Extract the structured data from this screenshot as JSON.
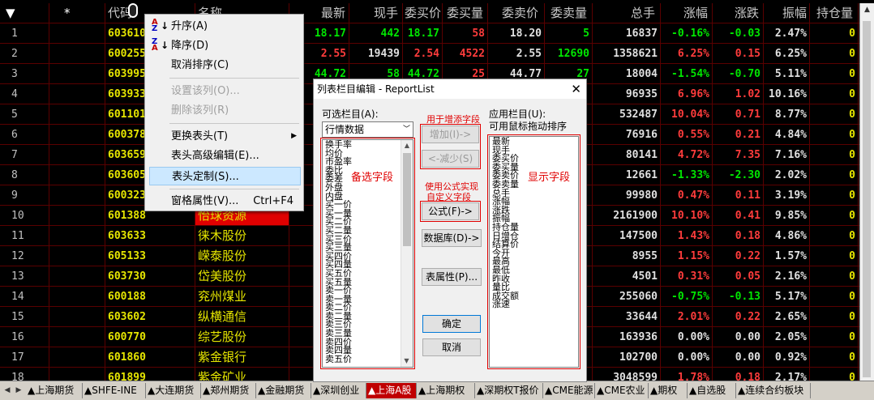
{
  "header": {
    "star": "*",
    "columns": [
      "代码",
      "名称",
      "最新",
      "现手",
      "委买价",
      "委买量",
      "委卖价",
      "委卖量",
      "总手",
      "涨幅",
      "涨跌",
      "振幅",
      "持仓量"
    ]
  },
  "rows": [
    {
      "n": "1",
      "code": "603610",
      "name": "",
      "last": "18.17",
      "vol": "442",
      "bid": "18.17",
      "bidq": "58",
      "ask": "18.20",
      "askq": "5",
      "total": "16837",
      "chg": "-0.16%",
      "diff": "-0.03",
      "amp": "2.47%",
      "oi": "0"
    },
    {
      "n": "2",
      "code": "600255",
      "name": "",
      "last": "2.55",
      "vol": "19439",
      "bid": "2.54",
      "bidq": "4522",
      "ask": "2.55",
      "askq": "12690",
      "total": "1358621",
      "chg": "6.25%",
      "diff": "0.15",
      "amp": "6.25%",
      "oi": "0"
    },
    {
      "n": "3",
      "code": "603995",
      "name": "",
      "last": "44.72",
      "vol": "58",
      "bid": "44.72",
      "bidq": "25",
      "ask": "44.77",
      "askq": "27",
      "total": "18004",
      "chg": "-1.54%",
      "diff": "-0.70",
      "amp": "5.11%",
      "oi": "0"
    },
    {
      "n": "4",
      "code": "603933",
      "name": "",
      "last": "",
      "vol": "",
      "bid": "",
      "bidq": "",
      "ask": "",
      "askq": "",
      "total": "96935",
      "chg": "6.96%",
      "diff": "1.02",
      "amp": "10.16%",
      "oi": "0"
    },
    {
      "n": "5",
      "code": "601101",
      "name": "",
      "last": "",
      "vol": "",
      "bid": "",
      "bidq": "",
      "ask": "",
      "askq": "",
      "total": "532487",
      "chg": "10.04%",
      "diff": "0.71",
      "amp": "8.77%",
      "oi": "0"
    },
    {
      "n": "6",
      "code": "600378",
      "name": "",
      "last": "",
      "vol": "",
      "bid": "",
      "bidq": "",
      "ask": "",
      "askq": "",
      "total": "76916",
      "chg": "0.55%",
      "diff": "0.21",
      "amp": "4.84%",
      "oi": "0"
    },
    {
      "n": "7",
      "code": "603659",
      "name": "",
      "last": "",
      "vol": "",
      "bid": "",
      "bidq": "",
      "ask": "",
      "askq": "",
      "total": "80141",
      "chg": "4.72%",
      "diff": "7.35",
      "amp": "7.16%",
      "oi": "0"
    },
    {
      "n": "8",
      "code": "603605",
      "name": "",
      "last": "",
      "vol": "",
      "bid": "",
      "bidq": "",
      "ask": "",
      "askq": "",
      "total": "12661",
      "chg": "-1.33%",
      "diff": "-2.30",
      "amp": "2.02%",
      "oi": "0"
    },
    {
      "n": "9",
      "code": "600323",
      "name": "",
      "last": "",
      "vol": "",
      "bid": "",
      "bidq": "",
      "ask": "",
      "askq": "",
      "total": "99980",
      "chg": "0.47%",
      "diff": "0.11",
      "amp": "3.19%",
      "oi": "0"
    },
    {
      "n": "10",
      "code": "601388",
      "name": "怡球资源",
      "last": "",
      "vol": "",
      "bid": "",
      "bidq": "",
      "ask": "",
      "askq": "",
      "total": "2161900",
      "chg": "10.10%",
      "diff": "0.41",
      "amp": "9.85%",
      "oi": "0"
    },
    {
      "n": "11",
      "code": "603633",
      "name": "徕木股份",
      "last": "",
      "vol": "",
      "bid": "",
      "bidq": "",
      "ask": "",
      "askq": "",
      "total": "147500",
      "chg": "1.43%",
      "diff": "0.18",
      "amp": "4.86%",
      "oi": "0"
    },
    {
      "n": "12",
      "code": "605133",
      "name": "嵘泰股份",
      "last": "",
      "vol": "",
      "bid": "",
      "bidq": "",
      "ask": "",
      "askq": "",
      "total": "8955",
      "chg": "1.15%",
      "diff": "0.22",
      "amp": "1.57%",
      "oi": "0"
    },
    {
      "n": "13",
      "code": "603730",
      "name": "岱美股份",
      "last": "",
      "vol": "",
      "bid": "",
      "bidq": "",
      "ask": "",
      "askq": "",
      "total": "4501",
      "chg": "0.31%",
      "diff": "0.05",
      "amp": "2.16%",
      "oi": "0"
    },
    {
      "n": "14",
      "code": "600188",
      "name": "兖州煤业",
      "last": "",
      "vol": "",
      "bid": "",
      "bidq": "",
      "ask": "",
      "askq": "",
      "total": "255060",
      "chg": "-0.75%",
      "diff": "-0.13",
      "amp": "5.17%",
      "oi": "0"
    },
    {
      "n": "15",
      "code": "603602",
      "name": "纵横通信",
      "last": "",
      "vol": "",
      "bid": "",
      "bidq": "",
      "ask": "",
      "askq": "",
      "total": "33644",
      "chg": "2.01%",
      "diff": "0.22",
      "amp": "2.65%",
      "oi": "0"
    },
    {
      "n": "16",
      "code": "600770",
      "name": "综艺股份",
      "last": "",
      "vol": "",
      "bid": "",
      "bidq": "",
      "ask": "",
      "askq": "",
      "total": "163936",
      "chg": "0.00%",
      "diff": "0.00",
      "amp": "2.05%",
      "oi": "0"
    },
    {
      "n": "17",
      "code": "601860",
      "name": "紫金银行",
      "last": "",
      "vol": "",
      "bid": "",
      "bidq": "",
      "ask": "",
      "askq": "",
      "total": "102700",
      "chg": "0.00%",
      "diff": "0.00",
      "amp": "0.92%",
      "oi": "0"
    },
    {
      "n": "18",
      "code": "601899",
      "name": "紫金矿业",
      "last": "",
      "vol": "",
      "bid": "",
      "bidq": "",
      "ask": "",
      "askq": "",
      "total": "3048599",
      "chg": "1.78%",
      "diff": "0.18",
      "amp": "2.17%",
      "oi": "0"
    }
  ],
  "tabs": [
    "▲上海期货",
    "▲SHFE-INE",
    "▲大连期货",
    "▲郑州期货",
    "▲金融期货",
    "▲深圳创业",
    "▲上海A股",
    "▲上海期权",
    "▲深期权T报价",
    "▲CME能源",
    "▲CME农业",
    "▲期权",
    "▲自选股",
    "▲连续合约板块"
  ],
  "active_tab": 6,
  "context_menu": {
    "asc": "升序(A)",
    "desc": "降序(D)",
    "cancel_sort": "取消排序(C)",
    "set_column": "设置该列(O)...",
    "delete_column": "删除该列(R)",
    "change_header": "更换表头(T)",
    "advanced_header": "表头高级编辑(E)...",
    "custom_header": "表头定制(S)...",
    "pane_props": "窗格属性(V)...",
    "pane_props_shortcut": "Ctrl+F4"
  },
  "dialog": {
    "title": "列表栏目编辑 - ReportList",
    "close": "✕",
    "available_label": "可选栏目(A):",
    "category": "行情数据",
    "applied_label": "应用栏目(U):",
    "applied_hint": "可用鼠标拖动排序",
    "add_hint": "用于增添字段",
    "add_btn": "增加(I)->",
    "remove_btn": "<-减少(S)",
    "formula_hint_1": "使用公式实现",
    "formula_hint_2": "自定义字段",
    "formula_btn": "公式(F)->",
    "db_btn": "数据库(D)->",
    "props_btn": "表属性(P)...",
    "ok_btn": "确定",
    "cancel_btn": "取消",
    "available_overlay": "备选字段",
    "applied_overlay": "显示字段",
    "available_items": [
      "换手率",
      "均价",
      "市盈率",
      "委比",
      "委差",
      "外盘",
      "内盘",
      "买一价",
      "买一量",
      "买二价",
      "买二量",
      "买三价",
      "买三量",
      "买四价",
      "买四量",
      "买五价",
      "买五量",
      "卖一价",
      "卖一量",
      "卖二价",
      "卖二量",
      "卖三价",
      "卖三量",
      "卖四价",
      "卖四量",
      "卖五价"
    ],
    "applied_items": [
      "最新",
      "现手",
      "委买价",
      "委买量",
      "委卖价",
      "委卖量",
      "总手",
      "涨幅",
      "涨跌",
      "振幅",
      "持仓量",
      "日增仓",
      "结算价",
      "今开",
      "最高",
      "最低",
      "昨收",
      "量比",
      "成交额",
      "涨速"
    ]
  }
}
